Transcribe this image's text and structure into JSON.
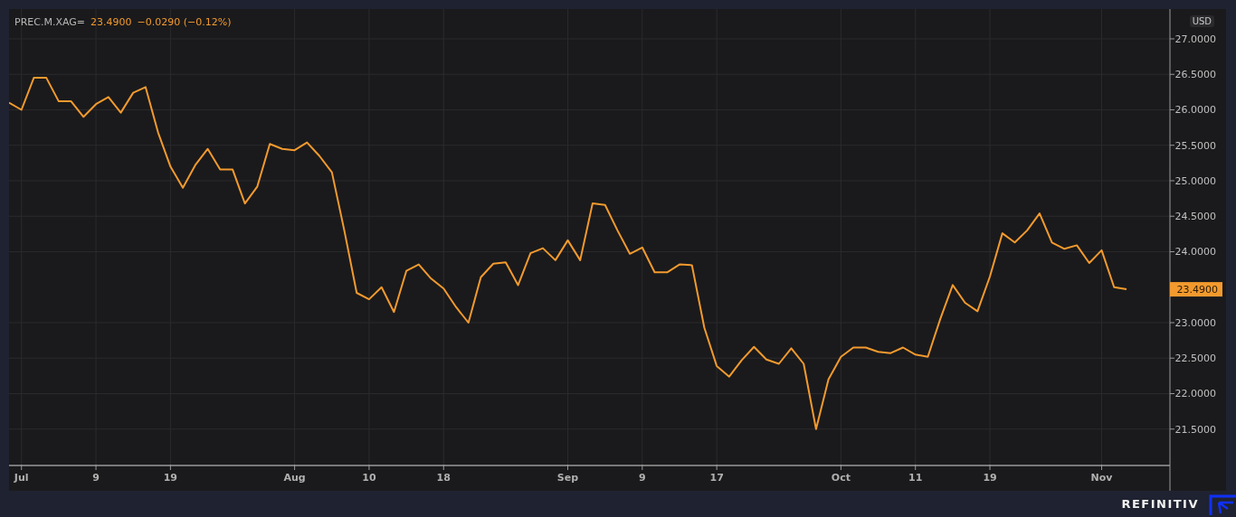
{
  "chart": {
    "header": {
      "price": "23.4900",
      "change": "−0.0290 (−0.12%)"
    },
    "currency": "USD",
    "last_price": "23.4900",
    "chart_data": {
      "type": "line",
      "grid": true,
      "ylim": [
        21.0,
        27.42
      ],
      "categories": [
        null,
        "Jul",
        null,
        null,
        null,
        null,
        null,
        "9",
        null,
        null,
        null,
        null,
        null,
        "19",
        null,
        null,
        null,
        null,
        null,
        null,
        null,
        null,
        null,
        "Aug",
        null,
        null,
        null,
        null,
        null,
        "10",
        null,
        null,
        null,
        null,
        null,
        "18",
        null,
        null,
        null,
        null,
        null,
        null,
        null,
        null,
        null,
        "Sep",
        null,
        null,
        null,
        null,
        null,
        "9",
        null,
        null,
        null,
        null,
        null,
        "17",
        null,
        null,
        null,
        null,
        null,
        null,
        null,
        null,
        null,
        "Oct",
        null,
        null,
        null,
        null,
        null,
        "11",
        null,
        null,
        null,
        null,
        null,
        "19",
        null,
        null,
        null,
        null,
        null,
        null,
        null,
        null,
        "Nov",
        null,
        null
      ],
      "yticks": [
        {
          "value": 27,
          "label": "27.0000"
        },
        {
          "value": 26.5,
          "label": "26.5000"
        },
        {
          "value": 26,
          "label": "26.0000"
        },
        {
          "value": 25.5,
          "label": "25.5000"
        },
        {
          "value": 25,
          "label": "25.0000"
        },
        {
          "value": 24.5,
          "label": "24.5000"
        },
        {
          "value": 24,
          "label": "24.0000"
        },
        {
          "value": 23,
          "label": "23.0000"
        },
        {
          "value": 22.5,
          "label": "22.5000"
        },
        {
          "value": 22,
          "label": "22.0000"
        },
        {
          "value": 21.5,
          "label": "21.5000"
        }
      ],
      "series": [
        {
          "name": "PREC.M.XAG=",
          "color": "#f39a2e",
          "values": [
            26.1,
            26.0,
            26.45,
            26.45,
            26.12,
            26.12,
            25.9,
            26.08,
            26.18,
            25.96,
            26.24,
            26.32,
            25.68,
            25.2,
            24.9,
            25.22,
            25.45,
            25.16,
            25.16,
            24.68,
            24.92,
            25.52,
            25.45,
            25.43,
            25.54,
            25.35,
            25.12,
            24.3,
            23.42,
            23.33,
            23.5,
            23.15,
            23.73,
            23.82,
            23.62,
            23.48,
            23.22,
            23.0,
            23.64,
            23.83,
            23.85,
            23.53,
            23.98,
            24.05,
            23.88,
            24.16,
            23.88,
            24.68,
            24.66,
            24.3,
            23.97,
            24.06,
            23.71,
            23.71,
            23.82,
            23.81,
            22.93,
            22.39,
            22.24,
            22.47,
            22.66,
            22.48,
            22.42,
            22.64,
            22.42,
            21.5,
            22.2,
            22.52,
            22.65,
            22.65,
            22.59,
            22.57,
            22.65,
            22.55,
            22.52,
            23.05,
            23.53,
            23.28,
            23.16,
            23.65,
            24.26,
            24.13,
            24.3,
            24.54,
            24.13,
            24.04,
            24.09,
            23.84,
            24.02,
            23.5,
            23.47
          ]
        }
      ]
    }
  },
  "brand": "REFINITIV"
}
